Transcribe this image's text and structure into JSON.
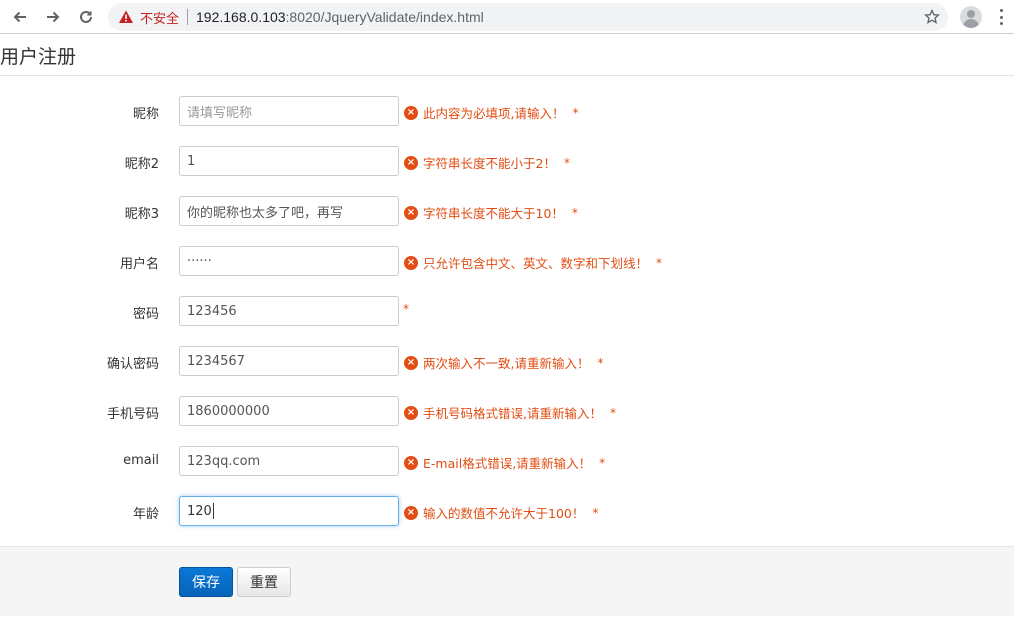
{
  "browser": {
    "security_label": "不安全",
    "url_host": "192.168.0.103",
    "url_rest": ":8020/JqueryValidate/index.html"
  },
  "page": {
    "title": "用户注册"
  },
  "form": {
    "fields": [
      {
        "label": "昵称",
        "value": "",
        "placeholder": "请填写昵称",
        "error": "此内容为必填项,请输入！",
        "required": "*"
      },
      {
        "label": "昵称2",
        "value": "1",
        "error": "字符串长度不能小于2！",
        "required": "*"
      },
      {
        "label": "昵称3",
        "value": "你的昵称也太多了吧，再写",
        "error": "字符串长度不能大于10！",
        "required": "*"
      },
      {
        "label": "用户名",
        "value": "······",
        "error": "只允许包含中文、英文、数字和下划线！",
        "required": "*"
      },
      {
        "label": "密码",
        "value": "123456",
        "error": "",
        "required": "*"
      },
      {
        "label": "确认密码",
        "value": "1234567",
        "error": "两次输入不一致,请重新输入！",
        "required": "*"
      },
      {
        "label": "手机号码",
        "value": "1860000000",
        "error": "手机号码格式错误,请重新输入！",
        "required": "*"
      },
      {
        "label": "email",
        "value": "123qq.com",
        "error": "E-mail格式错误,请重新输入！",
        "required": "*"
      },
      {
        "label": "年龄",
        "value": "120",
        "error": "输入的数值不允许大于100！",
        "required": "*"
      }
    ],
    "error_icon": "×"
  },
  "buttons": {
    "save": "保存",
    "reset": "重置"
  },
  "colors": {
    "error": "#e14d12",
    "primary": "#0664b8",
    "focus": "#66afe9"
  }
}
